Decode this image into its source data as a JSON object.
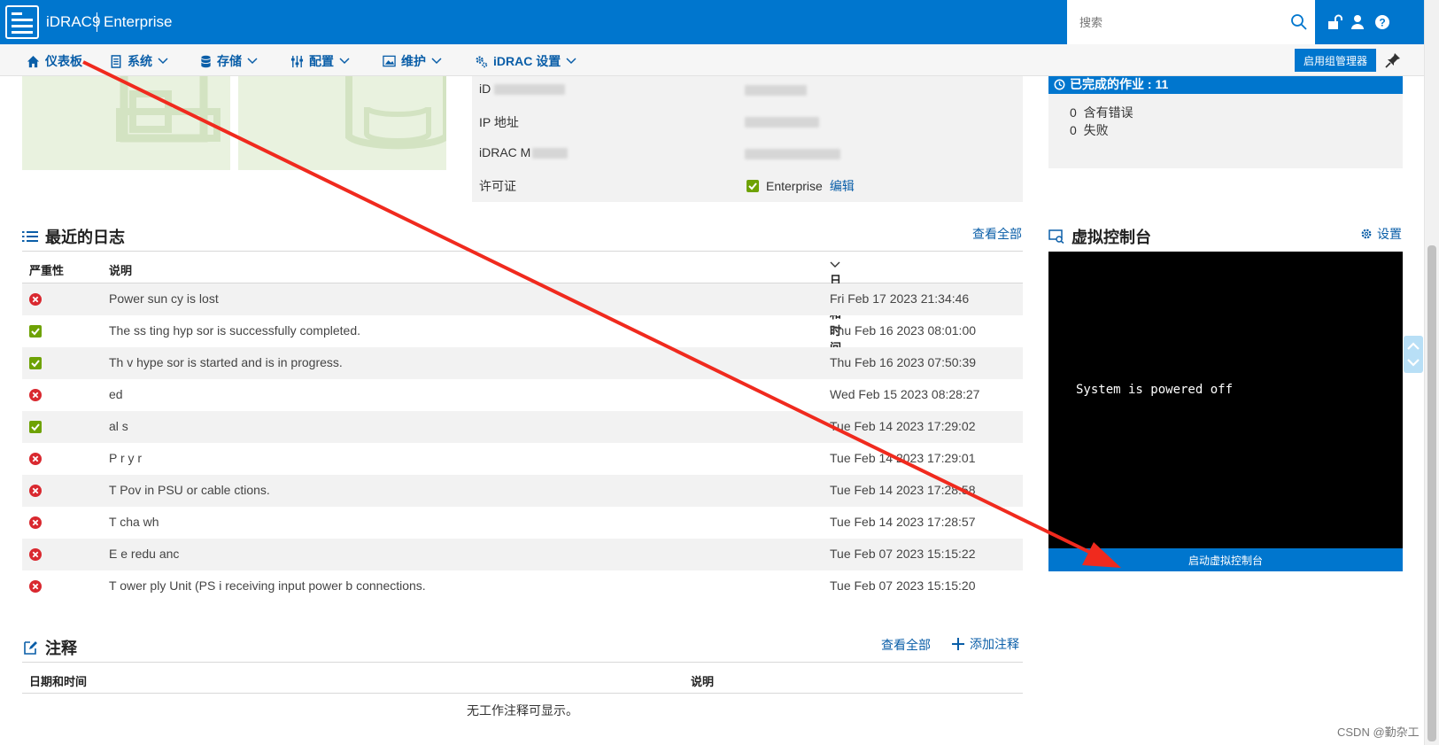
{
  "header": {
    "app_name": "iDRAC9",
    "edition": "Enterprise",
    "search_placeholder": "搜索"
  },
  "nav": {
    "items": [
      {
        "label": "仪表板"
      },
      {
        "label": "系统"
      },
      {
        "label": "存储"
      },
      {
        "label": "配置"
      },
      {
        "label": "维护"
      },
      {
        "label": "iDRAC 设置"
      }
    ],
    "group_manager_button": "启用组管理器"
  },
  "system_info": {
    "row1_label": "iD",
    "ip_label": "IP 地址",
    "mac_label": "iDRAC M",
    "license_label": "许可证",
    "license_value": "Enterprise",
    "license_edit": "编辑"
  },
  "jobs": {
    "title": "已完成的作业 : 11",
    "errors_count": "0",
    "errors_label": "含有错误",
    "failed_count": "0",
    "failed_label": "失败"
  },
  "recent_logs": {
    "title": "最近的日志",
    "view_all": "查看全部",
    "columns": {
      "severity": "严重性",
      "description": "说明",
      "datetime": "日期和时间"
    },
    "rows": [
      {
        "severity": "critical",
        "description": "Power sun                    cy is lost",
        "datetime": "Fri Feb 17 2023 21:34:46"
      },
      {
        "severity": "ok",
        "description": "The        ss                      ting              hyp     sor is successfully completed.",
        "datetime": "Thu Feb 16 2023 08:01:00"
      },
      {
        "severity": "ok",
        "description": "Th                                          v              hype    sor is started and is in progress.",
        "datetime": "Thu Feb 16 2023 07:50:39"
      },
      {
        "severity": "critical",
        "description": "              ed",
        "datetime": "Wed Feb 15 2023 08:28:27"
      },
      {
        "severity": "ok",
        "description": "          al          s",
        "datetime": "Tue Feb 14 2023 17:29:02"
      },
      {
        "severity": "critical",
        "description": "P       r          y r",
        "datetime": "Tue Feb 14 2023 17:29:01"
      },
      {
        "severity": "critical",
        "description": "T     Pov                                                           in PSU or cable          ctions.",
        "datetime": "Tue Feb 14 2023 17:28:58"
      },
      {
        "severity": "critical",
        "description": "T       cha                 wh",
        "datetime": "Tue Feb 14 2023 17:28:57"
      },
      {
        "severity": "critical",
        "description": "E       e            redu     anc",
        "datetime": "Tue Feb 07 2023 15:15:22"
      },
      {
        "severity": "critical",
        "description": "T       ower       ply Unit (PS         i      receiving input power b                                           connections.",
        "datetime": "Tue Feb 07 2023 15:15:20"
      }
    ]
  },
  "virtual_console": {
    "title": "虚拟控制台",
    "settings": "设置",
    "screen_text": "System is powered off",
    "launch_button": "启动虚拟控制台"
  },
  "notes": {
    "title": "注释",
    "view_all": "查看全部",
    "add_note": "添加注释",
    "columns": {
      "datetime": "日期和时间",
      "description": "说明"
    },
    "empty_text": "无工作注释可显示。"
  },
  "watermark": "CSDN @勤杂工",
  "colors": {
    "brand": "#0076ce",
    "critical": "#d9282f",
    "ok": "#6ea204",
    "annotation_arrow": "#f02a1e"
  }
}
